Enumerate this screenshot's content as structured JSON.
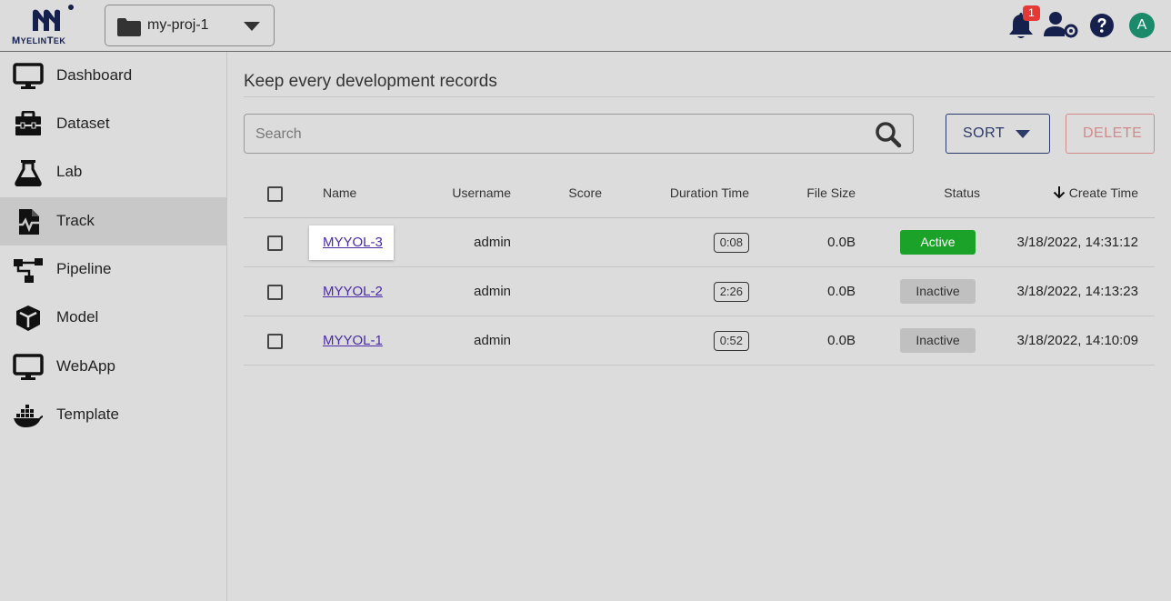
{
  "brand": {
    "name": "MyelinTek"
  },
  "header": {
    "project": "my-proj-1",
    "notification_count": "1",
    "avatar_letter": "A"
  },
  "sidebar": {
    "items": [
      {
        "label": "Dashboard",
        "icon": "monitor-icon"
      },
      {
        "label": "Dataset",
        "icon": "toolbox-icon"
      },
      {
        "label": "Lab",
        "icon": "flask-icon"
      },
      {
        "label": "Track",
        "icon": "file-waveform-icon",
        "active": true
      },
      {
        "label": "Pipeline",
        "icon": "pipeline-icon"
      },
      {
        "label": "Model",
        "icon": "cube-icon"
      },
      {
        "label": "WebApp",
        "icon": "monitor-icon"
      },
      {
        "label": "Template",
        "icon": "docker-icon"
      }
    ]
  },
  "main": {
    "title": "Keep every development records",
    "search_placeholder": "Search",
    "sort_label": "SORT",
    "delete_label": "DELETE"
  },
  "table": {
    "columns": {
      "name": "Name",
      "username": "Username",
      "score": "Score",
      "duration": "Duration Time",
      "size": "File Size",
      "status": "Status",
      "create_time": "Create Time"
    },
    "rows": [
      {
        "name": "MYYOL-3",
        "username": "admin",
        "score": "",
        "duration": "0:08",
        "size": "0.0B",
        "status": "Active",
        "create_time": "3/18/2022, 14:31:12"
      },
      {
        "name": "MYYOL-2",
        "username": "admin",
        "score": "",
        "duration": "2:26",
        "size": "0.0B",
        "status": "Inactive",
        "create_time": "3/18/2022, 14:13:23"
      },
      {
        "name": "MYYOL-1",
        "username": "admin",
        "score": "",
        "duration": "0:52",
        "size": "0.0B",
        "status": "Inactive",
        "create_time": "3/18/2022, 14:10:09"
      }
    ]
  },
  "colors": {
    "active": "#1aa328",
    "inactive": "#c0c0c0",
    "brand_navy": "#16204d",
    "link": "#4b2aa8",
    "badge": "#e53935",
    "avatar": "#1b8a6b"
  }
}
